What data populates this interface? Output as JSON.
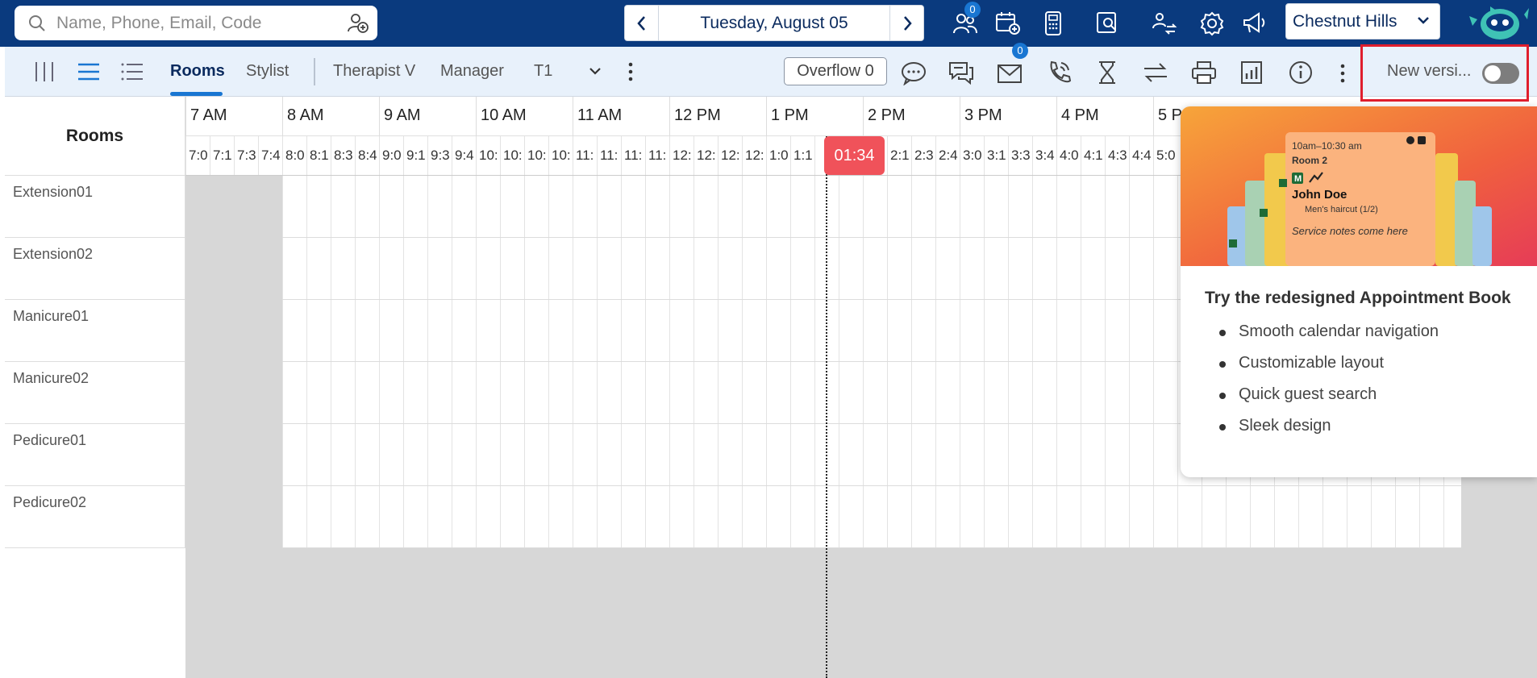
{
  "search": {
    "placeholder": "Name, Phone, Email, Code"
  },
  "date_nav": {
    "date": "Tuesday, August 05"
  },
  "top_icons": {
    "waitlist_badge": "0"
  },
  "location": {
    "name": "Chestnut Hills"
  },
  "tabs": [
    {
      "label": "Rooms"
    },
    {
      "label": "Stylist"
    },
    {
      "label": "Therapist V"
    },
    {
      "label": "Manager"
    },
    {
      "label": "T1"
    }
  ],
  "toolbar": {
    "overflow_label": "Overflow 0",
    "inbox_badge": "0",
    "new_version_label": "New versi..."
  },
  "grid": {
    "header": "Rooms",
    "hours": [
      "7 AM",
      "8 AM",
      "9 AM",
      "10 AM",
      "11 AM",
      "12 PM",
      "1 PM",
      "2 PM",
      "3 PM",
      "4 PM",
      "5 P"
    ],
    "slots": [
      "7:0",
      "7:1",
      "7:3",
      "7:4",
      "8:0",
      "8:1",
      "8:3",
      "8:4",
      "9:0",
      "9:1",
      "9:3",
      "9:4",
      "10:",
      "10:",
      "10:",
      "10:",
      "11:",
      "11:",
      "11:",
      "11:",
      "12:",
      "12:",
      "12:",
      "12:",
      "1:0",
      "1:1",
      "",
      "",
      "",
      "2:1",
      "2:3",
      "2:4",
      "3:0",
      "3:1",
      "3:3",
      "3:4",
      "4:0",
      "4:1",
      "4:3",
      "4:4",
      "5:0"
    ],
    "current_time": "01:34",
    "rooms": [
      "Extension01",
      "Extension02",
      "Manicure01",
      "Manicure02",
      "Pedicure01",
      "Pedicure02"
    ]
  },
  "promo": {
    "card_time": "10am–10:30 am",
    "card_room": "Room 2",
    "card_name": "John Doe",
    "card_service": "Men's haircut (1/2)",
    "card_notes": "Service notes come here",
    "title": "Try the redesigned Appointment Book",
    "bullets": [
      "Smooth calendar navigation",
      "Customizable layout",
      "Quick guest search",
      "Sleek design"
    ]
  }
}
